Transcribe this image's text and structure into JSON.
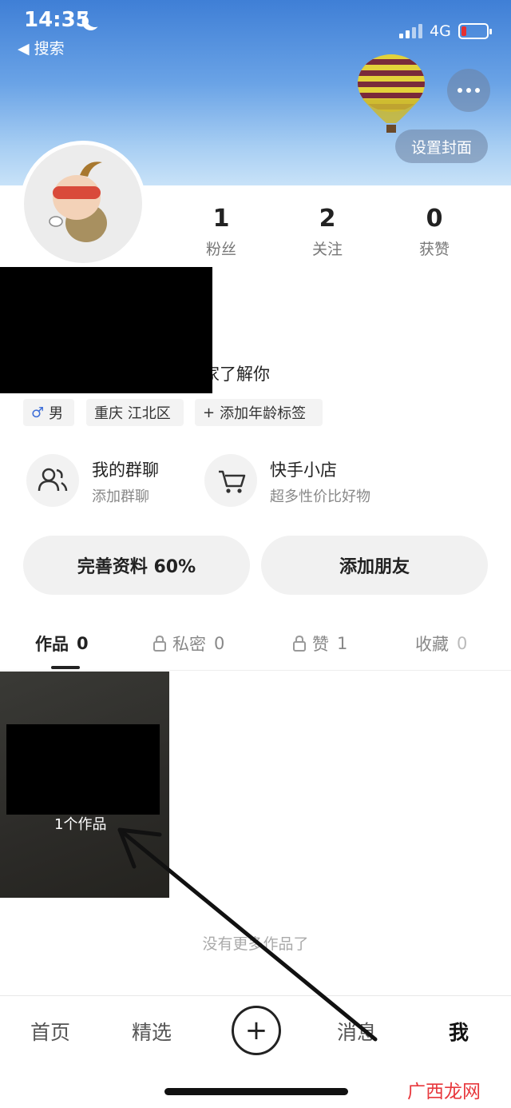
{
  "status_bar": {
    "time": "14:35",
    "back_label": "◀ 搜索",
    "network": "4G"
  },
  "cover": {
    "set_cover_label": "设置封面"
  },
  "stats": [
    {
      "value": "1",
      "label": "粉丝"
    },
    {
      "value": "2",
      "label": "关注"
    },
    {
      "value": "0",
      "label": "获赞"
    }
  ],
  "bio_visible_tail": "家了解你",
  "tags": {
    "gender": "男",
    "location": "重庆 江北区",
    "add_age": "添加年龄标签"
  },
  "entries": [
    {
      "title": "我的群聊",
      "subtitle": "添加群聊"
    },
    {
      "title": "快手小店",
      "subtitle": "超多性价比好物"
    }
  ],
  "buttons": {
    "complete_profile": "完善资料 60%",
    "add_friends": "添加朋友"
  },
  "tabs": [
    {
      "label": "作品",
      "count": "0"
    },
    {
      "label": "私密",
      "count": "0"
    },
    {
      "label": "赞",
      "count": "1"
    },
    {
      "label": "收藏",
      "count": "0"
    }
  ],
  "works": {
    "card_count_label": "1个作品",
    "empty_hint": "没有更多作品了"
  },
  "bottom_nav": {
    "home": "首页",
    "featured": "精选",
    "plus": "+",
    "messages": "消息",
    "me": "我"
  },
  "watermark": "广西龙网",
  "colors": {
    "battery_low": "#e53030",
    "watermark": "#e8383d",
    "gender_icon": "#3f6fd8"
  },
  "icons": {
    "more": "more-dots-icon",
    "group_chat": "group-people-icon",
    "shop": "shopping-cart-icon",
    "lock": "lock-icon",
    "gender": "male-icon"
  }
}
